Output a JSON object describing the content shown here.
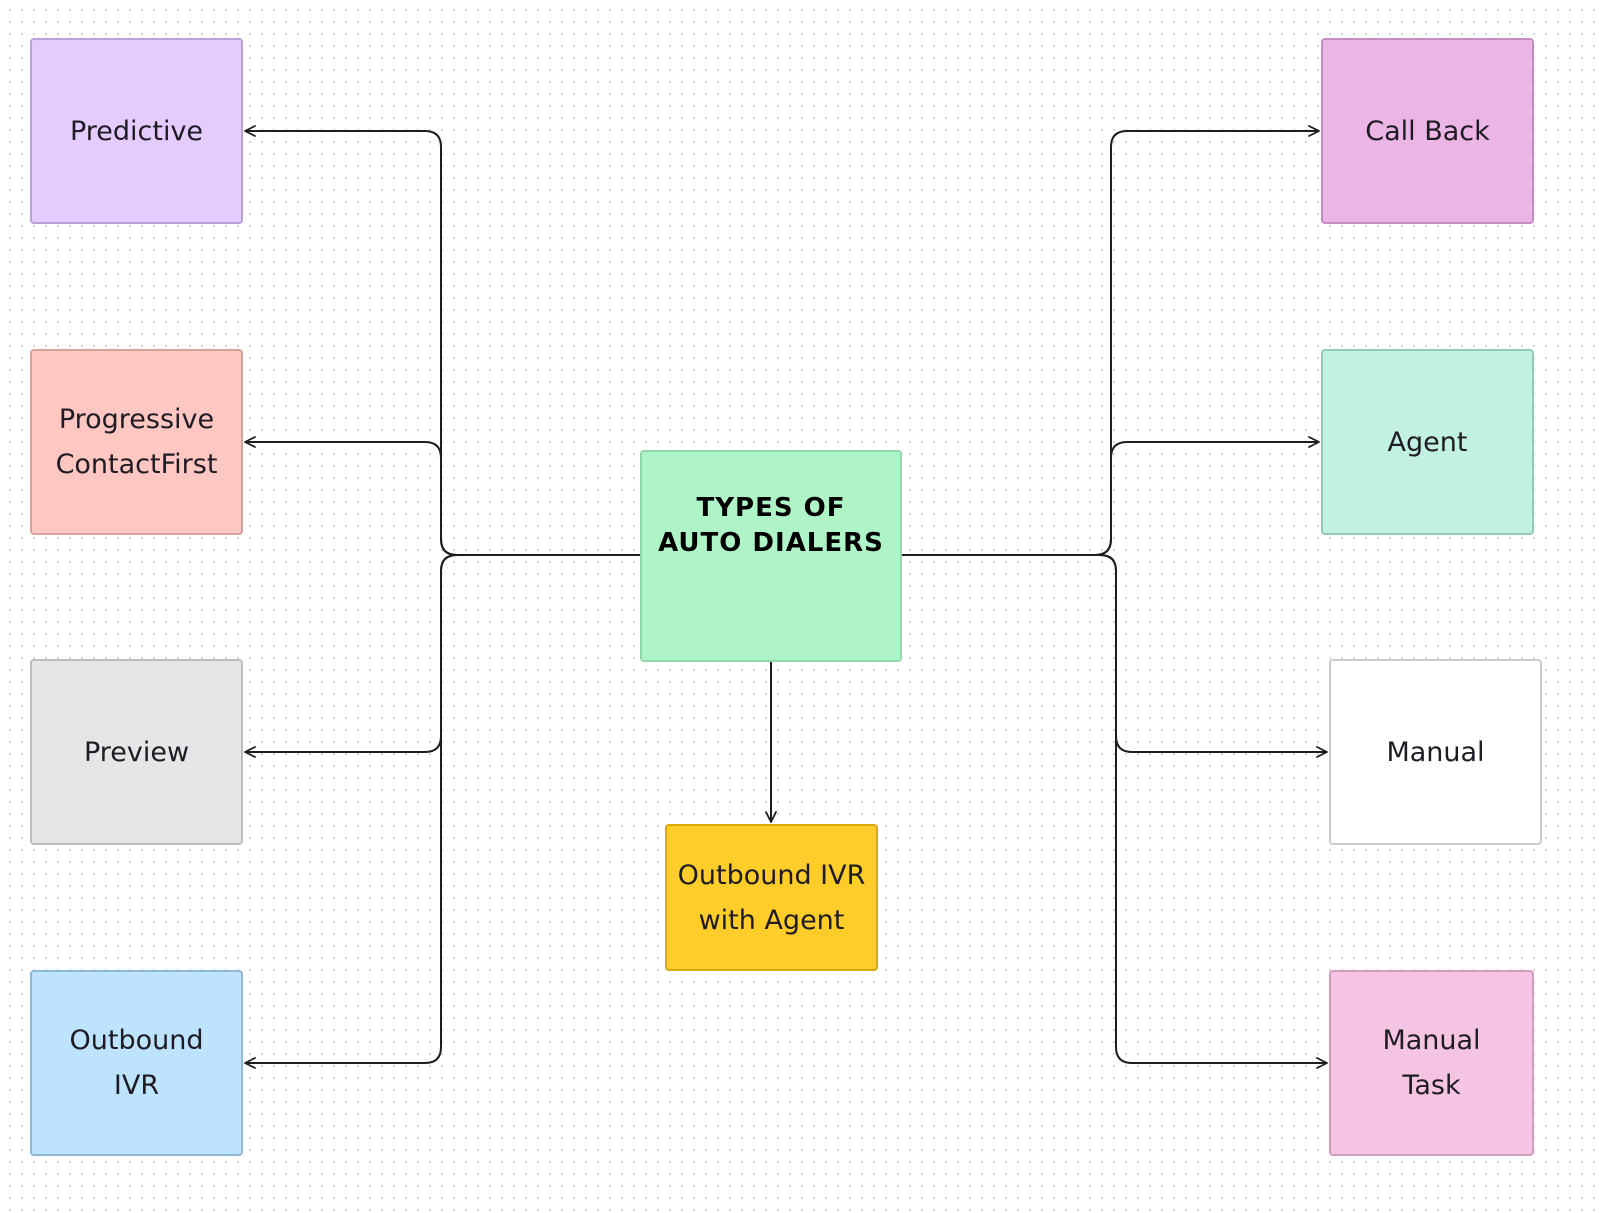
{
  "diagram": {
    "title": "TYPES OF\nAUTO DIALERS",
    "center": {
      "id": "center",
      "label": "TYPES OF\nAUTO DIALERS",
      "fill": "#aff4c6",
      "stroke": "#8fd8aa"
    },
    "nodes": [
      {
        "id": "predictive",
        "label": "Predictive",
        "fill": "#e4ccff",
        "stroke": "#b9a2d9",
        "side": "left"
      },
      {
        "id": "progressive",
        "label": "Progressive\nContactFirst",
        "fill": "#ffc7c2",
        "stroke": "#d9a19c",
        "side": "left"
      },
      {
        "id": "preview",
        "label": "Preview",
        "fill": "#e6e6e6",
        "stroke": "#bdbdbd",
        "side": "left"
      },
      {
        "id": "outbound-ivr",
        "label": "Outbound\nIVR",
        "fill": "#bde3ff",
        "stroke": "#8fb8d6",
        "side": "left"
      },
      {
        "id": "ivr-agent",
        "label": "Outbound IVR\nwith Agent",
        "fill": "#ffcd29",
        "stroke": "#d9a80f",
        "side": "bottom"
      },
      {
        "id": "callback",
        "label": "Call Back",
        "fill": "#ebb5e6",
        "stroke": "#c48ec0",
        "side": "right"
      },
      {
        "id": "agent",
        "label": "Agent",
        "fill": "#c2f0e1",
        "stroke": "#92c9b6",
        "side": "right"
      },
      {
        "id": "manual",
        "label": "Manual",
        "fill": "#ffffff",
        "stroke": "#cccccc",
        "side": "right"
      },
      {
        "id": "manual-task",
        "label": "Manual\nTask",
        "fill": "#f5c4e3",
        "stroke": "#cf9dbd",
        "side": "right"
      }
    ],
    "edges": [
      {
        "from": "center",
        "to": "predictive"
      },
      {
        "from": "center",
        "to": "progressive"
      },
      {
        "from": "center",
        "to": "preview"
      },
      {
        "from": "center",
        "to": "outbound-ivr"
      },
      {
        "from": "center",
        "to": "ivr-agent"
      },
      {
        "from": "center",
        "to": "callback"
      },
      {
        "from": "center",
        "to": "agent"
      },
      {
        "from": "center",
        "to": "manual"
      },
      {
        "from": "center",
        "to": "manual-task"
      }
    ],
    "edge_color": "#1e1e1e"
  }
}
